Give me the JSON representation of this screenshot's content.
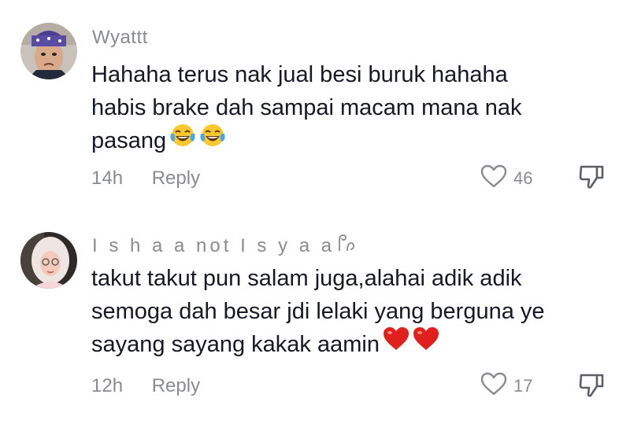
{
  "comments": [
    {
      "username": "Wyattt",
      "lines": [
        "Hahaha terus nak jual besi buruk hahaha",
        "habis brake dah sampai macam mana nak",
        "pasang"
      ],
      "emojis": [
        "face-with-tears-of-joy",
        "face-with-tears-of-joy"
      ],
      "time": "14h",
      "reply_label": "Reply",
      "like_count": "46",
      "like_icon": "heart-outline-icon",
      "dislike_icon": "thumbs-down-icon"
    },
    {
      "username": "I s h a a not I s y a a",
      "username_suffix_icon": "lao-character-glyph",
      "lines": [
        "takut takut pun salam juga,alahai adik adik",
        "semoga dah besar jdi lelaki yang berguna ye",
        "sayang sayang kakak aamin"
      ],
      "emojis": [
        "red-heart",
        "red-heart"
      ],
      "time": "12h",
      "reply_label": "Reply",
      "like_count": "17",
      "like_icon": "heart-outline-icon",
      "dislike_icon": "thumbs-down-icon"
    }
  ],
  "colors": {
    "text_primary": "#161823",
    "text_secondary": "#8a8b91",
    "heart_red": "#e0201c",
    "emoji_yellow": "#f9c72e"
  }
}
